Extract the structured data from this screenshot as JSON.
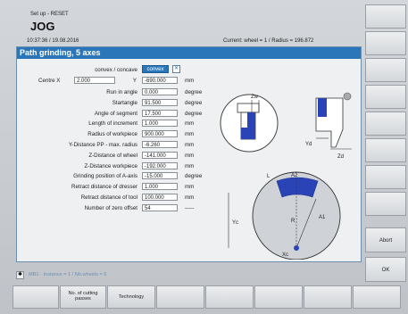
{
  "header": {
    "mode": "Set up - RESET",
    "title": "JOG",
    "datetime": "10:37:36 / 19.08.2016",
    "current": "Current:  wheel = 1  /  Radius = 196.872"
  },
  "panel": {
    "title": "Path grinding, 5 axes",
    "convex_label": "convex / concave",
    "convex_value": "convex",
    "centre_label": "Centre X",
    "centre_x": "2.000",
    "centre_y_label": "Y",
    "centre_y": "-690.000",
    "centre_unit": "mm",
    "params": [
      {
        "label": "Run in angle",
        "value": "0.000",
        "unit": "degree"
      },
      {
        "label": "Startangle",
        "value": "91.500",
        "unit": "degree"
      },
      {
        "label": "Angle of segment",
        "value": "17.500",
        "unit": "degree"
      },
      {
        "label": "Length of increment",
        "value": "1.000",
        "unit": "mm"
      },
      {
        "label": "Radius of workpiece",
        "value": "900.000",
        "unit": "mm"
      },
      {
        "label": "Y-Distance PP - max. radius",
        "value": "-6.260",
        "unit": "mm"
      },
      {
        "label": "Z-Distance of wheel",
        "value": "-141.000",
        "unit": "mm"
      },
      {
        "label": "Z-Distance workpiece",
        "value": "-192.000",
        "unit": "mm"
      },
      {
        "label": "Grinding position of A-axis",
        "value": "-15.000",
        "unit": "degree"
      },
      {
        "label": "Retract distance of dresser",
        "value": "1.000",
        "unit": "mm"
      },
      {
        "label": "Retract distance of tool",
        "value": "100.000",
        "unit": "mm"
      },
      {
        "label": "Number of zero offset",
        "value": "54",
        "unit": "-----"
      }
    ]
  },
  "diagram": {
    "zw": "Zw",
    "yd": "Yd",
    "zd": "Zd",
    "l": "L",
    "a2": "A2",
    "yc": "Yc",
    "r": "R",
    "a1": "A1",
    "xc": "Xc"
  },
  "status": {
    "text": "MB1 - Instance = 1 / Nb.wheels = 5"
  },
  "softkeys": {
    "abort": "Abort",
    "ok": "OK"
  },
  "hkeys": {
    "cutting": "No. of cutting passes",
    "technology": "Technology"
  },
  "colors": {
    "accent": "#2b76b8",
    "wheel": "#2a44b8"
  }
}
